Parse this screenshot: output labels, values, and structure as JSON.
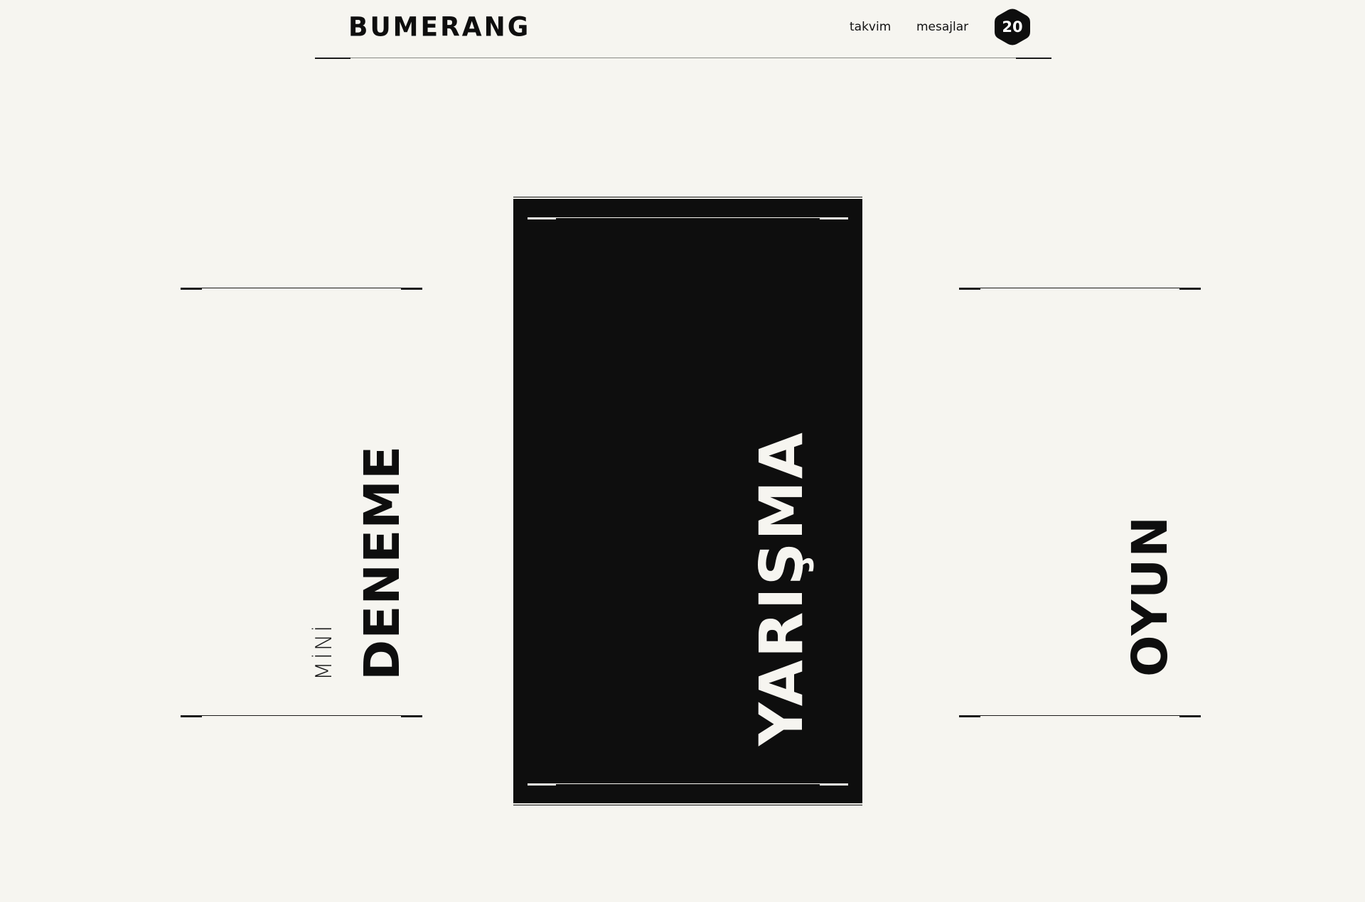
{
  "header": {
    "logo": "BUMERANG",
    "nav": {
      "calendar": "takvim",
      "messages": "mesajlar"
    },
    "badge_count": "20"
  },
  "cards": {
    "mini": {
      "label_small": "MİNİ",
      "label_big": "DENEME"
    },
    "main": {
      "label": "YARIŞMA"
    },
    "game": {
      "label": "OYUN"
    }
  },
  "colors": {
    "background": "#f6f5f0",
    "ink": "#0e0e0e",
    "card_text_on_dark": "#f6f5f0"
  },
  "icons": {
    "badge_shape": "hexagon-icon"
  }
}
